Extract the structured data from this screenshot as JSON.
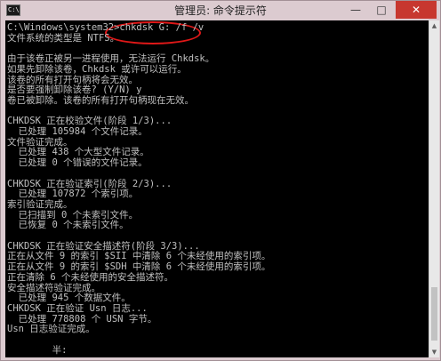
{
  "window": {
    "title": "管理员: 命令提示符",
    "icon_text": "C:\\",
    "minimize_glyph": "—",
    "maximize_glyph": "□",
    "close_glyph": "✕"
  },
  "colors": {
    "console_bg": "#000000",
    "console_text": "#c0c0c0",
    "annotation": "#e01818",
    "close_button": "#c7372f"
  },
  "console": {
    "lines": [
      "C:\\Windows\\system32>chkdsk G: /f /v",
      "文件系统的类型是 NTFS。",
      "",
      "由于该卷正被另一进程使用，无法运行 Chkdsk。",
      "如果先卸除该卷，Chkdsk 或许可以运行。",
      "该卷的所有打开句柄将会无效。",
      "是否要强制卸除该卷? (Y/N) y",
      "卷已被卸除。该卷的所有打开句柄现在无效。",
      "",
      "CHKDSK 正在校验文件(阶段 1/3)...",
      "  已处理 105984 个文件记录。",
      "文件验证完成。",
      "  已处理 438 个大型文件记录。",
      "  已处理 0 个错误的文件记录。",
      "",
      "CHKDSK 正在验证索引(阶段 2/3)...",
      "  已处理 107872 个索引项。",
      "索引验证完成。",
      "  已扫描到 0 个未索引文件。",
      "  已恢复 0 个未索引文件。",
      "",
      "CHKDSK 正在验证安全描述符(阶段 3/3)...",
      "正在从文件 9 的索引 $SII 中清除 6 个未经使用的索引项。",
      "正在从文件 9 的索引 $SDH 中清除 6 个未经使用的索引项。",
      "正在清除 6 个未经使用的安全描述符。",
      "安全描述符验证完成。",
      "  已处理 945 个数据文件。",
      "CHKDSK 正在验证 Usn 日志...",
      "  已处理 778808 个 USN 字节。",
      "Usn 日志验证完成。",
      "",
      "        半:"
    ]
  },
  "scrollbar": {
    "up_glyph": "▲",
    "down_glyph": "▼"
  }
}
